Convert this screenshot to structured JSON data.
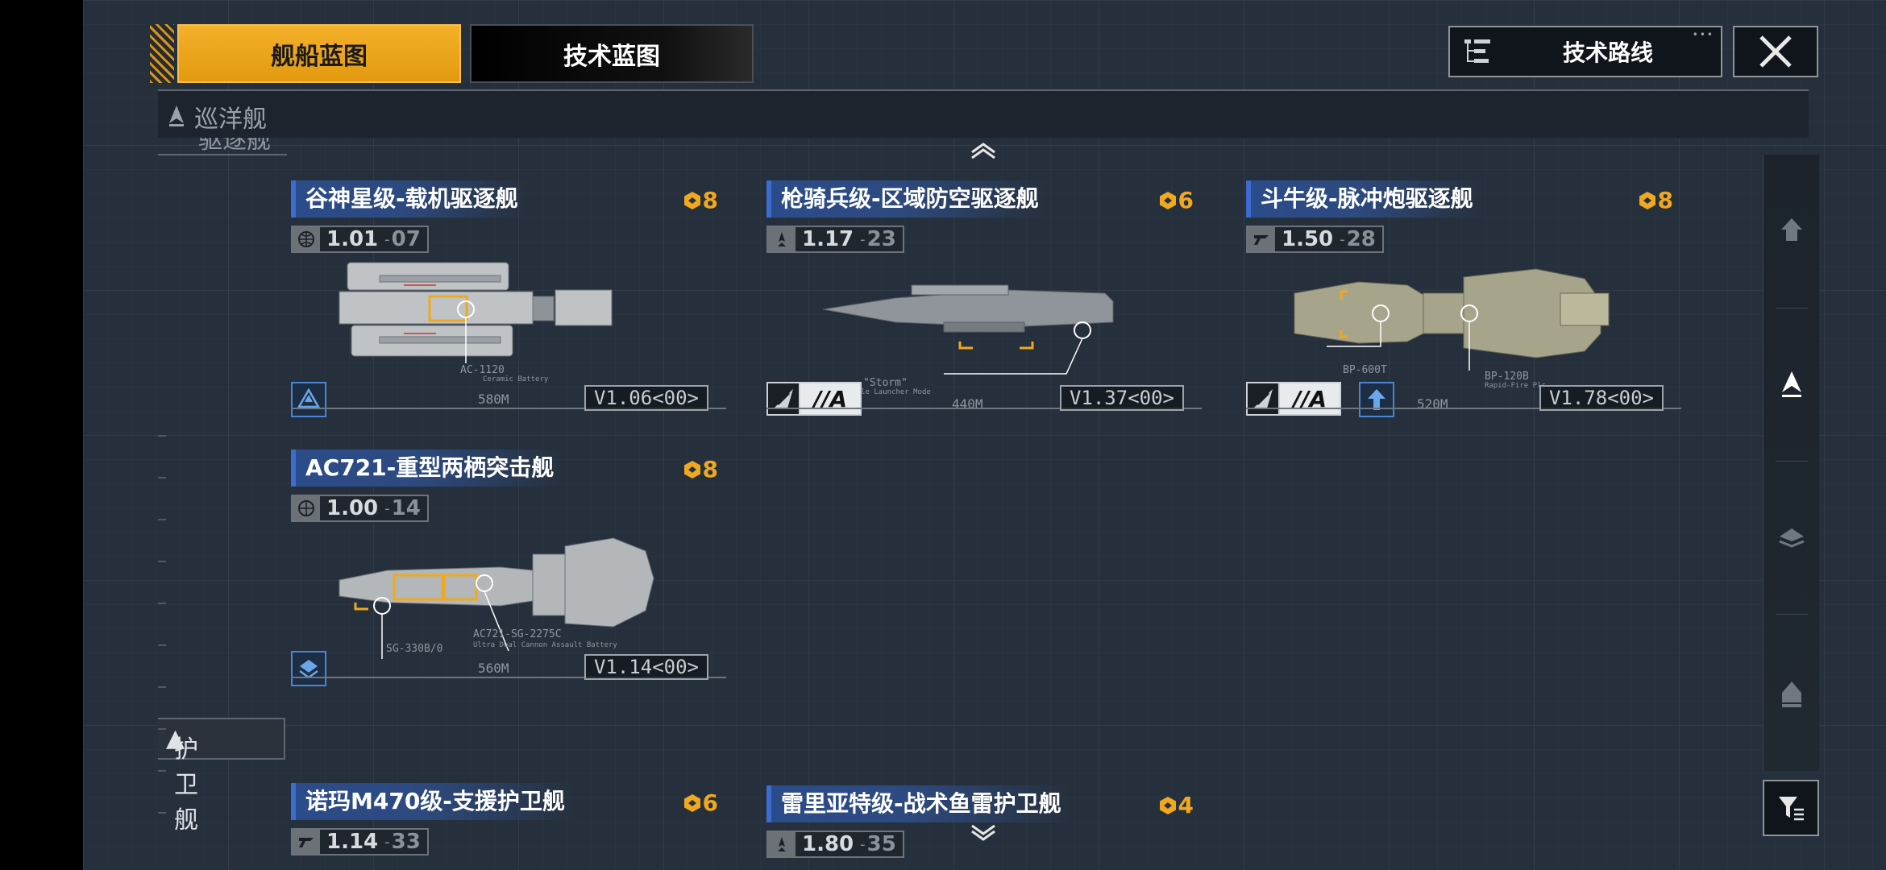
{
  "tabs": {
    "ship_blueprint": "舰船蓝图",
    "tech_blueprint": "技术蓝图",
    "tech_route": "技术路线"
  },
  "sections": {
    "cruiser": "巡洋舰",
    "destroyer_partial": "驱逐舰",
    "frigate": "护卫舰"
  },
  "cards": [
    {
      "title": "谷神星级-载机驱逐舰",
      "cost": "8",
      "version": "1.01",
      "version_sub": "07",
      "tag": "V1.06<00>",
      "length": "580M",
      "module": "AC-1120",
      "module_sub": "Ceramic Battery",
      "type_letter": null
    },
    {
      "title": "枪骑兵级-区域防空驱逐舰",
      "cost": "6",
      "version": "1.17",
      "version_sub": "23",
      "tag": "V1.37<00>",
      "length": "440M",
      "module": "\"Storm\"",
      "module_sub": "Missile Launcher Mode",
      "type_letter": "A"
    },
    {
      "title": "斗牛级-脉冲炮驱逐舰",
      "cost": "8",
      "version": "1.50",
      "version_sub": "28",
      "tag": "V1.78<00>",
      "length": "520M",
      "module": "BP-600T",
      "module_sub": "",
      "module2": "BP-120B",
      "module2_sub": "Rapid-Fire Pls...",
      "type_letter": "A"
    },
    {
      "title": "AC721-重型两栖突击舰",
      "cost": "8",
      "version": "1.00",
      "version_sub": "14",
      "tag": "V1.14<00>",
      "length": "560M",
      "module": "AC721-SG-2275C",
      "module_sub": "Ultra Dual Cannon Assault Battery",
      "module2": "SG-330B/0",
      "type_letter": null
    },
    {
      "title": "诺玛M470级-支援护卫舰",
      "cost": "6",
      "version": "1.14",
      "version_sub": "33"
    },
    {
      "title": "雷里亚特级-战术鱼雷护卫舰",
      "cost": "4",
      "version": "1.80",
      "version_sub": "35"
    }
  ],
  "colors": {
    "accent": "#f0a81f",
    "title_bar": "#2d4a80",
    "background": "#26303c"
  },
  "icons": {
    "close": "close-icon",
    "tech_route": "tree-list-icon",
    "filter": "filter-icon",
    "cost": "hex-coin-icon"
  }
}
